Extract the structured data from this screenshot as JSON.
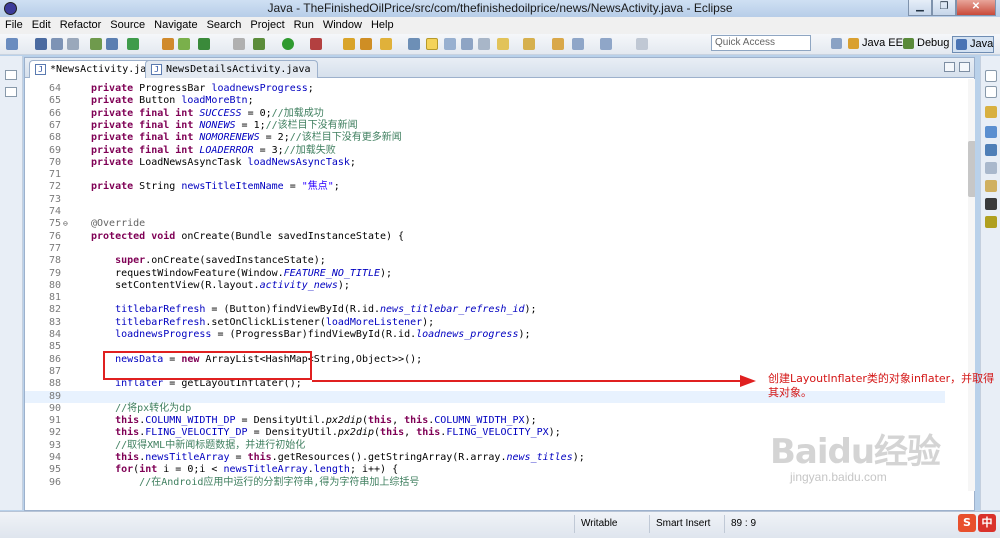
{
  "window": {
    "title": "Java - TheFinishedOilPrice/src/com/thefinishedoilprice/news/NewsActivity.java - Eclipse"
  },
  "window_controls": {
    "minimize": "▁",
    "restore": "❐",
    "close": "✕"
  },
  "menu": [
    "File",
    "Edit",
    "Refactor",
    "Source",
    "Navigate",
    "Search",
    "Project",
    "Run",
    "Window",
    "Help"
  ],
  "quick_access": {
    "placeholder": "Quick Access"
  },
  "perspectives": [
    {
      "label": "Java EE",
      "active": false
    },
    {
      "label": "Debug",
      "active": false
    },
    {
      "label": "Java",
      "active": true
    }
  ],
  "tabs": [
    {
      "label": "*NewsActivity.java",
      "active": true
    },
    {
      "label": "NewsDetailsActivity.java",
      "active": false
    }
  ],
  "code_lines": [
    {
      "n": "64",
      "html": "<span class='k'>private</span> ProgressBar <span class='f'>loadnewsProgress</span>;"
    },
    {
      "n": "65",
      "html": "<span class='k'>private</span> Button <span class='f'>loadMoreBtn</span>;"
    },
    {
      "n": "66",
      "html": "<span class='k'>private final int</span> <span class='fi'>SUCCESS</span> = 0;<span class='c'>//加载成功</span>"
    },
    {
      "n": "67",
      "html": "<span class='k'>private final int</span> <span class='fi'>NONEWS</span> = 1;<span class='c'>//该栏目下没有新闻</span>"
    },
    {
      "n": "68",
      "html": "<span class='k'>private final int</span> <span class='fi'>NOMORENEWS</span> = 2;<span class='c'>//该栏目下没有更多新闻</span>"
    },
    {
      "n": "69",
      "html": "<span class='k'>private final int</span> <span class='fi'>LOADERROR</span> = 3;<span class='c'>//加载失败</span>"
    },
    {
      "n": "70",
      "html": "<span class='k'>private</span> LoadNewsAsyncTask <span class='f'>loadNewsAsyncTask</span>;"
    },
    {
      "n": "71",
      "html": ""
    },
    {
      "n": "72",
      "html": "<span class='k'>private</span> String <span class='f'>newsTitleItemName</span> = <span class='s'>\"焦点\"</span>;"
    },
    {
      "n": "73",
      "html": ""
    },
    {
      "n": "74",
      "html": ""
    },
    {
      "n": "75",
      "html": "<span class='a'>@Override</span>",
      "fold": "⊖"
    },
    {
      "n": "76",
      "html": "<span class='k'>protected void</span> onCreate(Bundle savedInstanceState) {"
    },
    {
      "n": "77",
      "html": ""
    },
    {
      "n": "78",
      "html": "    <span class='k'>super</span>.onCreate(savedInstanceState);"
    },
    {
      "n": "79",
      "html": "    requestWindowFeature(Window.<span class='fi'>FEATURE_NO_TITLE</span>);"
    },
    {
      "n": "80",
      "html": "    setContentView(R.layout.<span class='fi'>activity_news</span>);"
    },
    {
      "n": "81",
      "html": ""
    },
    {
      "n": "82",
      "html": "    <span class='f'>titlebarRefresh</span> = (Button)findViewById(R.id.<span class='fi'>news_titlebar_refresh_id</span>);"
    },
    {
      "n": "83",
      "html": "    <span class='f'>titlebarRefresh</span>.setOnClickListener(<span class='f'>loadMoreListener</span>);"
    },
    {
      "n": "84",
      "html": "    <span class='f'>loadnewsProgress</span> = (ProgressBar)findViewById(R.id.<span class='fi'>loadnews_progress</span>);"
    },
    {
      "n": "85",
      "html": ""
    },
    {
      "n": "86",
      "html": "    <span class='f'>newsData</span> = <span class='k'>new</span> ArrayList&lt;HashMap&lt;String,Object&gt;&gt;();"
    },
    {
      "n": "87",
      "html": ""
    },
    {
      "n": "88",
      "html": "    <span class='f'>inflater</span> = getLayoutInflater();"
    },
    {
      "n": "89",
      "html": "",
      "current": true
    },
    {
      "n": "90",
      "html": "    <span class='c'>//将px转化为dp</span>"
    },
    {
      "n": "91",
      "html": "    <span class='k'>this</span>.<span class='f'>COLUMN_WIDTH_DP</span> = DensityUtil.<span class='i'>px2dip</span>(<span class='k'>this</span>, <span class='k'>this</span>.<span class='f'>COLUMN_WIDTH_PX</span>);"
    },
    {
      "n": "92",
      "html": "    <span class='k'>this</span>.<span class='f'>FLING_VELOCITY_DP</span> = DensityUtil.<span class='i'>px2dip</span>(<span class='k'>this</span>, <span class='k'>this</span>.<span class='f'>FLING_VELOCITY_PX</span>);"
    },
    {
      "n": "93",
      "html": "    <span class='c'>//取得XML中新闻标题数据，并进行初始化</span>"
    },
    {
      "n": "94",
      "html": "    <span class='k'>this</span>.<span class='f'>newsTitleArray</span> = <span class='k'>this</span>.getResources().getStringArray(R.array.<span class='fi'>news_titles</span>);"
    },
    {
      "n": "95",
      "html": "    <span class='k'>for</span>(<span class='k'>int</span> i = 0;i &lt; <span class='f'>newsTitleArray</span>.<span class='f'>length</span>; i++) {"
    },
    {
      "n": "96",
      "html": "        <span class='c'>//在Android应用中运行的分割字符串,得为字符串加上综括号</span>"
    }
  ],
  "annotation": {
    "text": "创建LayoutInflater类的对象inflater，并取得其对象。",
    "color": "#d41717"
  },
  "status": {
    "writable": "Writable",
    "insert_mode": "Smart Insert",
    "position": "89 : 9"
  },
  "watermark": {
    "brand": "Baidu经验",
    "url": "jingyan.baidu.com"
  },
  "tray": [
    {
      "label": "S",
      "color": "#e8502d"
    },
    {
      "label": "中",
      "color": "#d9322b"
    }
  ],
  "colors": {
    "keyword": "#7f0055",
    "comment": "#3f7f5f",
    "string": "#2a00ff",
    "field": "#0000c0",
    "highlight_box": "#e02020"
  }
}
